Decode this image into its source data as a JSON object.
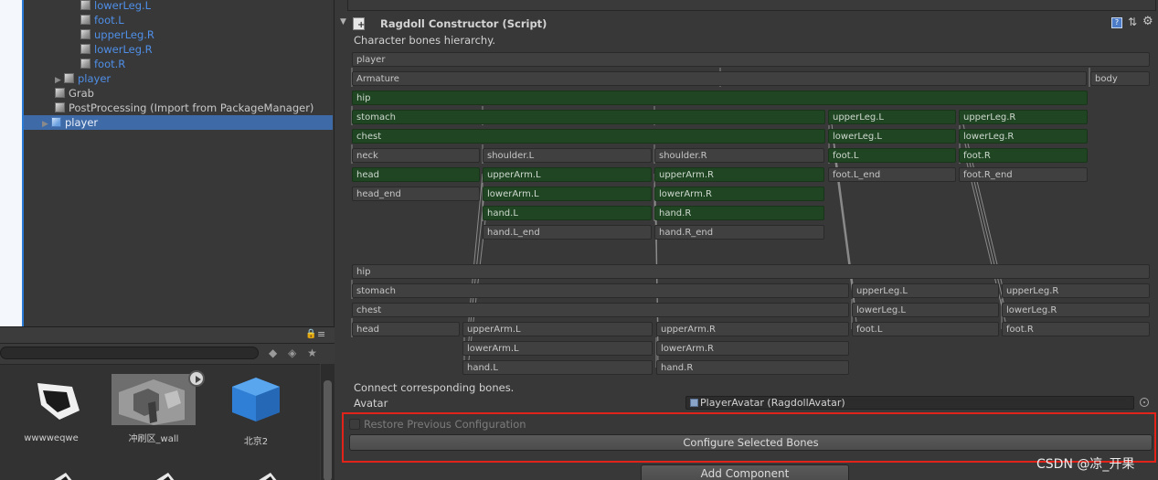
{
  "hierarchy": {
    "items": [
      {
        "label": "lowerLeg.L"
      },
      {
        "label": "foot.L"
      },
      {
        "label": "upperLeg.R"
      },
      {
        "label": "lowerLeg.R"
      },
      {
        "label": "foot.R"
      },
      {
        "label": "player"
      },
      {
        "label": "Grab"
      },
      {
        "label": "PostProcessing (Import from PackageManager)"
      },
      {
        "label": "player"
      }
    ]
  },
  "project": {
    "assets": [
      {
        "label": "wwwweqwe"
      },
      {
        "label": "冲刷区_wall"
      },
      {
        "label": "北京2"
      }
    ]
  },
  "inspector": {
    "component_title": "Ragdoll Constructor (Script)",
    "subtitle": "Character bones hierarchy.",
    "bones_top": {
      "player": "player",
      "armature": "Armature",
      "body": "body",
      "hip": "hip",
      "stomach": "stomach",
      "upperLegL": "upperLeg.L",
      "upperLegR": "upperLeg.R",
      "chest": "chest",
      "lowerLegL": "lowerLeg.L",
      "lowerLegR": "lowerLeg.R",
      "neck": "neck",
      "shoulderL": "shoulder.L",
      "shoulderR": "shoulder.R",
      "footL": "foot.L",
      "footR": "foot.R",
      "head": "head",
      "upperArmL": "upperArm.L",
      "upperArmR": "upperArm.R",
      "footLEnd": "foot.L_end",
      "footREnd": "foot.R_end",
      "headEnd": "head_end",
      "lowerArmL": "lowerArm.L",
      "lowerArmR": "lowerArm.R",
      "handL": "hand.L",
      "handR": "hand.R",
      "handLEnd": "hand.L_end",
      "handREnd": "hand.R_end"
    },
    "bones_bottom": {
      "hip": "hip",
      "stomach": "stomach",
      "upperLegL": "upperLeg.L",
      "upperLegR": "upperLeg.R",
      "chest": "chest",
      "lowerLegL": "lowerLeg.L",
      "lowerLegR": "lowerLeg.R",
      "head": "head",
      "upperArmL": "upperArm.L",
      "upperArmR": "upperArm.R",
      "footL": "foot.L",
      "footR": "foot.R",
      "lowerArmL": "lowerArm.L",
      "lowerArmR": "lowerArm.R",
      "handL": "hand.L",
      "handR": "hand.R"
    },
    "connect_label": "Connect corresponding bones.",
    "avatar_label": "Avatar",
    "avatar_value": "PlayerAvatar (RagdollAvatar)",
    "restore_label": "Restore Previous Configuration",
    "restore_checked": false,
    "configure_button": "Configure Selected Bones",
    "add_component_button": "Add Component"
  },
  "watermark": "CSDN @凉_开果",
  "colors": {
    "background": "#383838",
    "selected_bone": "#1f4523",
    "selection": "#3e6aa8",
    "highlight_border": "#e2231a"
  }
}
